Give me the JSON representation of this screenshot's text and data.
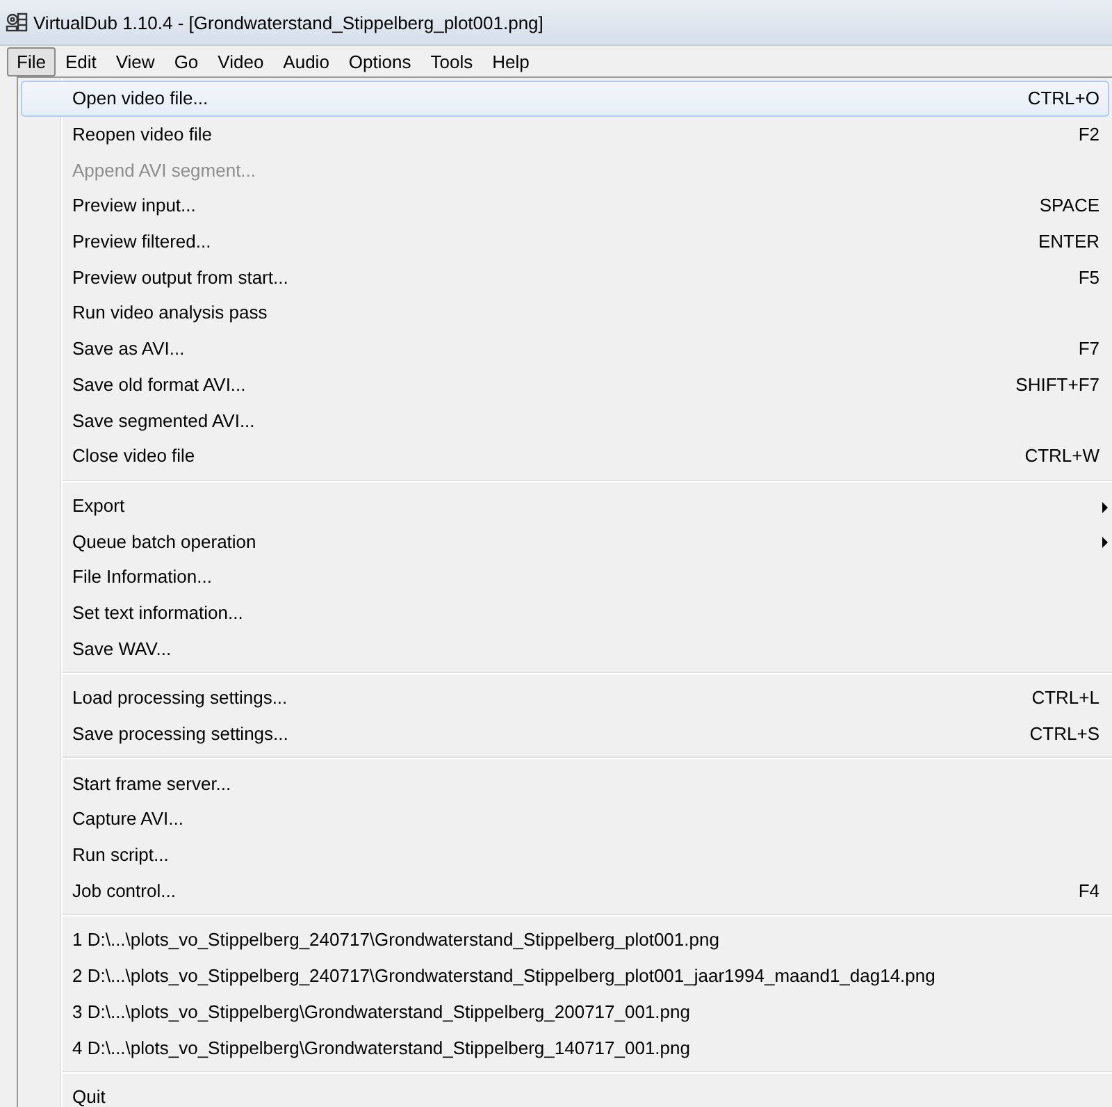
{
  "window": {
    "title": "VirtualDub 1.10.4 - [Grondwaterstand_Stippelberg_plot001.png]"
  },
  "menubar": [
    {
      "label": "File",
      "selected": true
    },
    {
      "label": "Edit",
      "selected": false
    },
    {
      "label": "View",
      "selected": false
    },
    {
      "label": "Go",
      "selected": false
    },
    {
      "label": "Video",
      "selected": false
    },
    {
      "label": "Audio",
      "selected": false
    },
    {
      "label": "Options",
      "selected": false
    },
    {
      "label": "Tools",
      "selected": false
    },
    {
      "label": "Help",
      "selected": false
    }
  ],
  "menu": [
    {
      "kind": "item",
      "label": "Open video file...",
      "shortcut": "CTRL+O",
      "disabled": false,
      "selected": true
    },
    {
      "kind": "item",
      "label": "Reopen video file",
      "shortcut": "F2",
      "disabled": false,
      "selected": false
    },
    {
      "kind": "item",
      "label": "Append AVI segment...",
      "disabled": true,
      "selected": false
    },
    {
      "kind": "item",
      "label": "Preview input...",
      "shortcut": "SPACE",
      "disabled": false,
      "selected": false
    },
    {
      "kind": "item",
      "label": "Preview filtered...",
      "shortcut": "ENTER",
      "disabled": false,
      "selected": false
    },
    {
      "kind": "item",
      "label": "Preview output from start...",
      "shortcut": "F5",
      "disabled": false,
      "selected": false
    },
    {
      "kind": "item",
      "label": "Run video analysis pass",
      "disabled": false,
      "selected": false
    },
    {
      "kind": "item",
      "label": "Save as AVI...",
      "shortcut": "F7",
      "disabled": false,
      "selected": false
    },
    {
      "kind": "item",
      "label": "Save old format AVI...",
      "shortcut": "SHIFT+F7",
      "disabled": false,
      "selected": false
    },
    {
      "kind": "item",
      "label": "Save segmented AVI...",
      "disabled": false,
      "selected": false
    },
    {
      "kind": "item",
      "label": "Close video file",
      "shortcut": "CTRL+W",
      "disabled": false,
      "selected": false
    },
    {
      "kind": "separator"
    },
    {
      "kind": "submenu",
      "label": "Export",
      "disabled": false,
      "selected": false
    },
    {
      "kind": "submenu",
      "label": "Queue batch operation",
      "disabled": false,
      "selected": false
    },
    {
      "kind": "item",
      "label": "File Information...",
      "disabled": false,
      "selected": false
    },
    {
      "kind": "item",
      "label": "Set text information...",
      "disabled": false,
      "selected": false
    },
    {
      "kind": "item",
      "label": "Save WAV...",
      "disabled": false,
      "selected": false
    },
    {
      "kind": "separator"
    },
    {
      "kind": "item",
      "label": "Load processing settings...",
      "shortcut": "CTRL+L",
      "disabled": false,
      "selected": false
    },
    {
      "kind": "item",
      "label": "Save processing settings...",
      "shortcut": "CTRL+S",
      "disabled": false,
      "selected": false
    },
    {
      "kind": "separator"
    },
    {
      "kind": "item",
      "label": "Start frame server...",
      "disabled": false,
      "selected": false
    },
    {
      "kind": "item",
      "label": "Capture AVI...",
      "disabled": false,
      "selected": false
    },
    {
      "kind": "item",
      "label": "Run script...",
      "disabled": false,
      "selected": false
    },
    {
      "kind": "item",
      "label": "Job control...",
      "shortcut": "F4",
      "disabled": false,
      "selected": false
    },
    {
      "kind": "separator"
    },
    {
      "kind": "item",
      "label": "1 D:\\...\\plots_vo_Stippelberg_240717\\Grondwaterstand_Stippelberg_plot001.png",
      "disabled": false,
      "selected": false
    },
    {
      "kind": "item",
      "label": "2 D:\\...\\plots_vo_Stippelberg_240717\\Grondwaterstand_Stippelberg_plot001_jaar1994_maand1_dag14.png",
      "disabled": false,
      "selected": false
    },
    {
      "kind": "item",
      "label": "3 D:\\...\\plots_vo_Stippelberg\\Grondwaterstand_Stippelberg_200717_001.png",
      "disabled": false,
      "selected": false
    },
    {
      "kind": "item",
      "label": "4 D:\\...\\plots_vo_Stippelberg\\Grondwaterstand_Stippelberg_140717_001.png",
      "disabled": false,
      "selected": false
    },
    {
      "kind": "separator"
    },
    {
      "kind": "item",
      "label": "Quit",
      "disabled": false,
      "selected": false
    }
  ]
}
